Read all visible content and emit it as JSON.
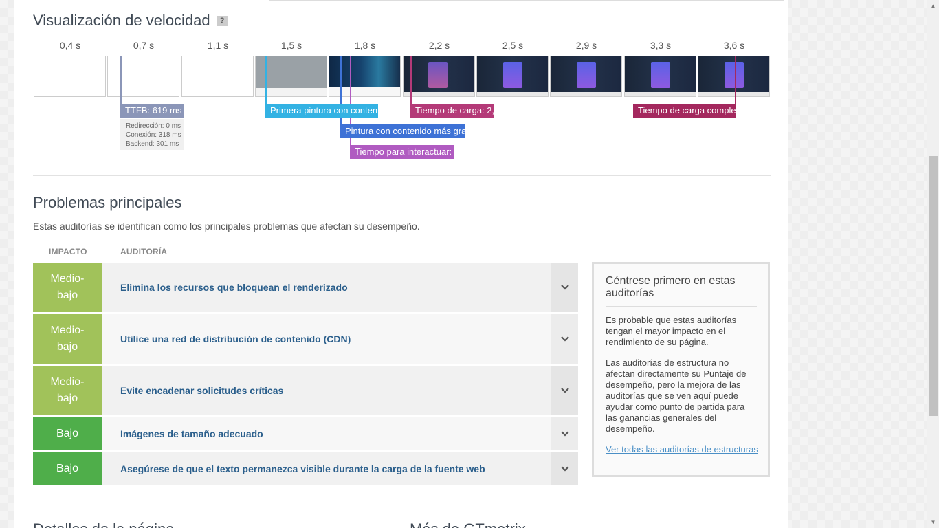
{
  "speed": {
    "title": "Visualización de velocidad",
    "help": "?",
    "times": [
      "0,4 s",
      "0,7 s",
      "1,1 s",
      "1,5 s",
      "1,8 s",
      "2,2 s",
      "2,5 s",
      "2,9 s",
      "3,3 s",
      "3,6 s"
    ],
    "ttfb": {
      "label": "TTFB: 619 ms",
      "redirect": "Redirección: 0 ms",
      "connection": "Conexión: 318 ms",
      "backend": "Backend: 301 ms"
    },
    "markers": {
      "fcp": "Primera pintura con contenido:",
      "lcp": "Pintura con contenido más grande:",
      "tti": "Tiempo para interactuar:",
      "onload": "Tiempo de carga: 2,",
      "fully": "Tiempo de carga completo:"
    },
    "colors": {
      "ttfb": "#8b96b8",
      "fcp": "#33b2e3",
      "lcp": "#3e72d6",
      "tti": "#b05bc1",
      "onload": "#b43a78",
      "fully": "#a4285e"
    }
  },
  "problems": {
    "title": "Problemas principales",
    "intro": "Estas auditorías se identifican como los principales problemas que afectan su desempeño.",
    "col_impact": "IMPACTO",
    "col_audit": "AUDITORÍA",
    "rows": [
      {
        "impact_line1": "Medio-",
        "impact_line2": "bajo",
        "audit": "Elimina los recursos que bloquean el renderizado"
      },
      {
        "impact_line1": "Medio-",
        "impact_line2": "bajo",
        "audit": "Utilice una red de distribución de contenido (CDN)"
      },
      {
        "impact_line1": "Medio-",
        "impact_line2": "bajo",
        "audit": "Evite encadenar solicitudes críticas"
      },
      {
        "impact_line1": "Bajo",
        "audit": "Imágenes de tamaño adecuado"
      },
      {
        "impact_line1": "Bajo",
        "audit": "Asegúrese de que el texto permanezca visible durante la carga de la fuente web"
      }
    ],
    "colors": {
      "medio_bajo": "#a1c25a",
      "bajo": "#4fae4a",
      "audit_text": "#2b5f8c"
    }
  },
  "sidebox": {
    "title": "Céntrese primero en estas auditorías",
    "p1": "Es probable que estas auditorías tengan el mayor impacto en el rendimiento de su página.",
    "p2": "Las auditorías de estructura no afectan directamente su Puntaje de desempeño, pero la mejora de las auditorías que se ven aquí puede ayudar como punto de partida para las ganancias generales del desempeño.",
    "link": "Ver todas las auditorías de estructuras"
  },
  "bottom": {
    "left_title": "Detalles de la página",
    "right_title": "Más de GTmetrix"
  }
}
